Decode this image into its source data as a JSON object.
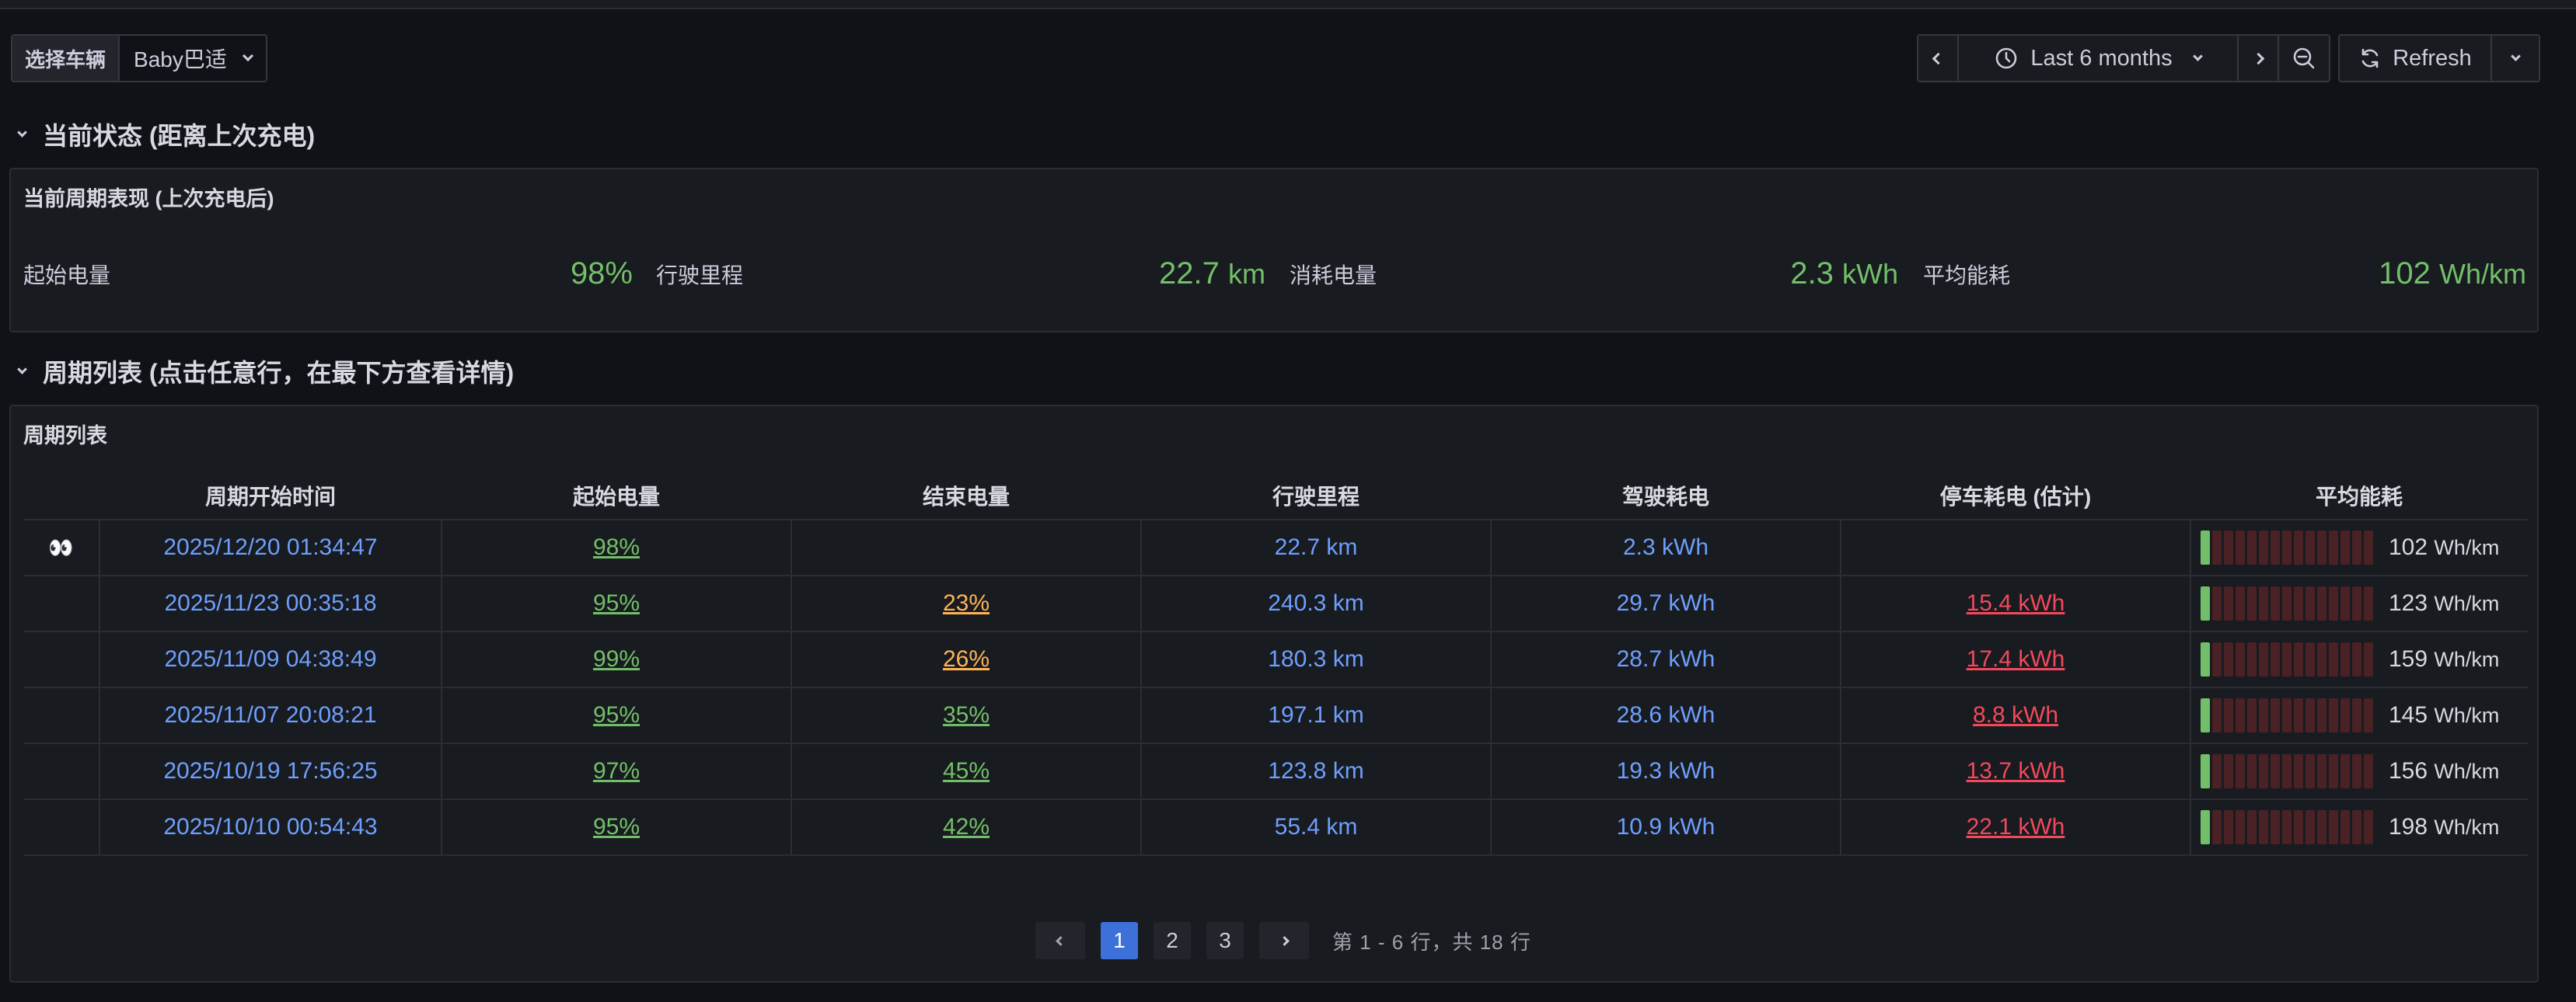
{
  "toolbar": {
    "var_label": "选择车辆",
    "var_value": "Baby巴适",
    "time_range": "Last 6 months",
    "refresh_label": "Refresh"
  },
  "sections": {
    "current": "当前状态 (距离上次充电)",
    "cycles": "周期列表 (点击任意行，在最下方查看详情)"
  },
  "current_panel": {
    "title": "当前周期表现 (上次充电后)",
    "stats": [
      {
        "label": "起始电量",
        "value": "98%"
      },
      {
        "label": "行驶里程",
        "value": "22.7",
        "unit": "km"
      },
      {
        "label": "消耗电量",
        "value": "2.3",
        "unit": "kWh"
      },
      {
        "label": "平均能耗",
        "value": "102",
        "unit": "Wh/km"
      }
    ]
  },
  "cycles_panel": {
    "title": "周期列表",
    "columns": [
      "",
      "周期开始时间",
      "起始电量",
      "结束电量",
      "行驶里程",
      "驾驶耗电",
      "停车耗电 (估计)",
      "平均能耗"
    ],
    "rows": [
      {
        "marker": "👀",
        "start": "2025/12/20 01:34:47",
        "start_soc": "98%",
        "end_soc": "",
        "end_color": "",
        "distance": "22.7 km",
        "drive_energy": "2.3 kWh",
        "park_energy": "",
        "efficiency": "102",
        "eff_unit": "Wh/km"
      },
      {
        "marker": "",
        "start": "2025/11/23 00:35:18",
        "start_soc": "95%",
        "end_soc": "23%",
        "end_color": "orange",
        "distance": "240.3 km",
        "drive_energy": "29.7 kWh",
        "park_energy": "15.4 kWh",
        "efficiency": "123",
        "eff_unit": "Wh/km"
      },
      {
        "marker": "",
        "start": "2025/11/09 04:38:49",
        "start_soc": "99%",
        "end_soc": "26%",
        "end_color": "orange",
        "distance": "180.3 km",
        "drive_energy": "28.7 kWh",
        "park_energy": "17.4 kWh",
        "efficiency": "159",
        "eff_unit": "Wh/km"
      },
      {
        "marker": "",
        "start": "2025/11/07 20:08:21",
        "start_soc": "95%",
        "end_soc": "35%",
        "end_color": "green",
        "distance": "197.1 km",
        "drive_energy": "28.6 kWh",
        "park_energy": "8.8 kWh",
        "efficiency": "145",
        "eff_unit": "Wh/km"
      },
      {
        "marker": "",
        "start": "2025/10/19 17:56:25",
        "start_soc": "97%",
        "end_soc": "45%",
        "end_color": "green",
        "distance": "123.8 km",
        "drive_energy": "19.3 kWh",
        "park_energy": "13.7 kWh",
        "efficiency": "156",
        "eff_unit": "Wh/km"
      },
      {
        "marker": "",
        "start": "2025/10/10 00:54:43",
        "start_soc": "95%",
        "end_soc": "42%",
        "end_color": "green",
        "distance": "55.4 km",
        "drive_energy": "10.9 kWh",
        "park_energy": "22.1 kWh",
        "efficiency": "198",
        "eff_unit": "Wh/km"
      }
    ],
    "pagination": {
      "pages": [
        "1",
        "2",
        "3"
      ],
      "active": "1",
      "info": "第 1 - 6 行，共 18 行"
    }
  },
  "colors": {
    "background": "#111217",
    "panel": "#181b1f",
    "green": "#73bf69",
    "blue": "#6e9fff",
    "orange": "#ffb357",
    "red": "#f2495c",
    "active_page": "#3d71d9"
  }
}
